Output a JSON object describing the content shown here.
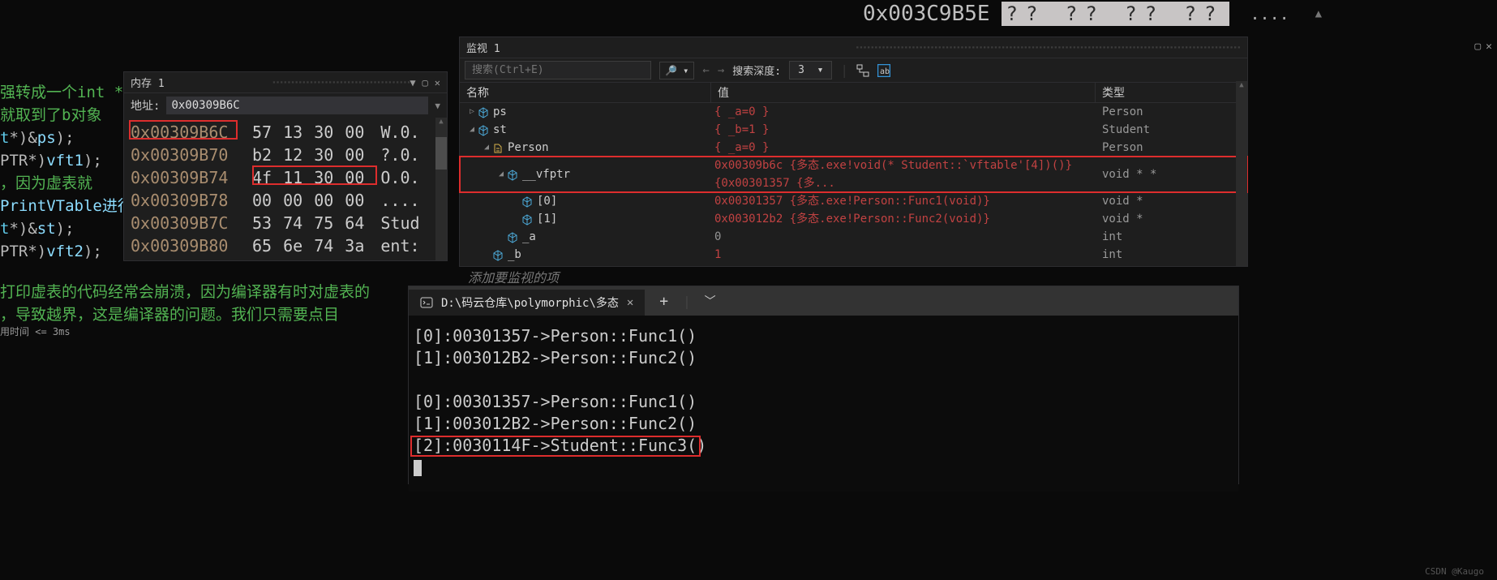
{
  "top": {
    "addr": "0x003C9B5E",
    "hex": "?? ?? ?? ??",
    "dots": "...."
  },
  "code": {
    "l1": "强转成一个int *",
    "l2": "就取到了b对象",
    "l3a": "*)&",
    "l3b": "ps",
    "l3c": ");",
    "l4a": "PTR*)",
    "l4b": "vft1",
    "l4c": ");",
    "l5": "，因为虚表就",
    "l6": "PrintVTable进行",
    "l7a": "*)&",
    "l7b": "st",
    "l7c": ");",
    "l8a": "PTR*)",
    "l8b": "vft2",
    "l8c": ");",
    "l9": "打印虚表的代码经常会崩溃，因为编译器有时对虚表的",
    "l10": "，导致越界，这是编译器的问题。我们只需要点目",
    "time": "用时间 <= 3ms"
  },
  "memory": {
    "title": "内存 1",
    "addrLabel": "地址:",
    "addrValue": "0x00309B6C",
    "rows": [
      {
        "addr": "0x00309B6C",
        "hex": [
          "57",
          "13",
          "30",
          "00"
        ],
        "txt": "W.0."
      },
      {
        "addr": "0x00309B70",
        "hex": [
          "b2",
          "12",
          "30",
          "00"
        ],
        "txt": "?.0."
      },
      {
        "addr": "0x00309B74",
        "hex": [
          "4f",
          "11",
          "30",
          "00"
        ],
        "txt": "O.0."
      },
      {
        "addr": "0x00309B78",
        "hex": [
          "00",
          "00",
          "00",
          "00"
        ],
        "txt": "...."
      },
      {
        "addr": "0x00309B7C",
        "hex": [
          "53",
          "74",
          "75",
          "64"
        ],
        "txt": "Stud"
      },
      {
        "addr": "0x00309B80",
        "hex": [
          "65",
          "6e",
          "74",
          "3a"
        ],
        "txt": "ent:"
      }
    ]
  },
  "watch": {
    "title": "监视 1",
    "searchPlaceholder": "搜索(Ctrl+E)",
    "depthLabel": "搜索深度:",
    "depthValue": "3",
    "cols": {
      "name": "名称",
      "value": "值",
      "type": "类型"
    },
    "rows": [
      {
        "indent": 0,
        "expand": "▷",
        "icon": "cube",
        "name": "ps",
        "value": "{ _a=0 }",
        "type": "Person",
        "valueClass": "val-red"
      },
      {
        "indent": 0,
        "expand": "◢",
        "icon": "cube",
        "name": "st",
        "value": "{ _b=1 }",
        "type": "Student",
        "valueClass": "val-red"
      },
      {
        "indent": 1,
        "expand": "◢",
        "icon": "inherit",
        "name": "Person",
        "value": "{ _a=0 }",
        "type": "Person",
        "valueClass": "val-red"
      },
      {
        "indent": 2,
        "expand": "◢",
        "icon": "cube",
        "name": "__vfptr",
        "value": "0x00309b6c {多态.exe!void(* Student::`vftable'[4])()} {0x00301357 {多...",
        "type": "void * *",
        "valueClass": "val-red",
        "sel": true
      },
      {
        "indent": 3,
        "expand": "",
        "icon": "cube",
        "name": "[0]",
        "value": "0x00301357 {多态.exe!Person::Func1(void)}",
        "type": "void *",
        "valueClass": "val-red"
      },
      {
        "indent": 3,
        "expand": "",
        "icon": "cube",
        "name": "[1]",
        "value": "0x003012b2 {多态.exe!Person::Func2(void)}",
        "type": "void *",
        "valueClass": "val-red"
      },
      {
        "indent": 2,
        "expand": "",
        "icon": "cube",
        "name": "_a",
        "value": "0",
        "type": "int",
        "valueClass": ""
      },
      {
        "indent": 1,
        "expand": "",
        "icon": "cube",
        "name": "_b",
        "value": "1",
        "type": "int",
        "valueClass": "val-red"
      }
    ],
    "addItem": "添加要监视的项"
  },
  "terminal": {
    "tabTitle": "D:\\码云仓库\\polymorphic\\多态",
    "lines": [
      "[0]:00301357->Person::Func1()",
      "[1]:003012B2->Person::Func2()",
      "",
      "[0]:00301357->Person::Func1()",
      "[1]:003012B2->Person::Func2()",
      "[2]:0030114F->Student::Func3()"
    ]
  },
  "watermark": "CSDN @Kaugo"
}
